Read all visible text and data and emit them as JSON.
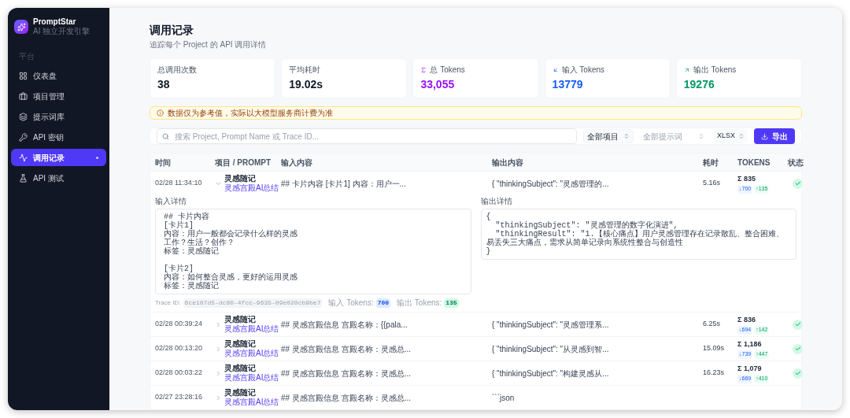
{
  "brand": {
    "name": "PromptStar",
    "tagline": "AI 独立开发引擎"
  },
  "nav_section": "平台",
  "nav": [
    {
      "label": "仪表盘",
      "selected": false
    },
    {
      "label": "项目管理",
      "selected": false
    },
    {
      "label": "提示词库",
      "selected": false
    },
    {
      "label": "API 密钥",
      "selected": false
    },
    {
      "label": "调用记录",
      "selected": true
    },
    {
      "label": "API 测试",
      "selected": false
    }
  ],
  "header": {
    "title": "调用记录",
    "subtitle": "追踪每个 Project 的 API 调用详情"
  },
  "stats": [
    {
      "label": "总调用次数",
      "value": "38",
      "kind": "plain"
    },
    {
      "label": "平均耗时",
      "value": "19.02s",
      "kind": "plain"
    },
    {
      "label": "总 Tokens",
      "value": "33,055",
      "kind": "total"
    },
    {
      "label": "输入 Tokens",
      "value": "13779",
      "kind": "input"
    },
    {
      "label": "输出 Tokens",
      "value": "19276",
      "kind": "output"
    }
  ],
  "notice": "数据仅为参考值，实际以大模型服务商计费为准",
  "filters": {
    "search_placeholder": "搜索 Project, Prompt Name 或 Trace ID...",
    "project": "全部项目",
    "prompt": "全部提示词",
    "format": "XLSX",
    "export": "导出"
  },
  "table": {
    "columns": [
      "时间",
      "项目 / PROMPT",
      "输入内容",
      "输出内容",
      "耗时",
      "TOKENS",
      "状态"
    ],
    "rows": [
      {
        "time": "02/28 11:34:10",
        "project": "灵感随记",
        "prompt": "灵感宫殿AI总结",
        "input": "## 卡片内容 [卡片1] 内容：用户一...",
        "output": "{ \"thinkingSubject\": \"灵感管理的...",
        "duration": "5.16s",
        "total": "Σ 835",
        "in": "↓700",
        "out": "↑135",
        "success": true,
        "expanded": true
      },
      {
        "time": "02/28 00:39:24",
        "project": "灵感随记",
        "prompt": "灵感宫殿AI总结",
        "input": "## 灵感宫殿信息 宫殿名称：{{pala...",
        "output": "{ \"thinkingSubject\": \"灵感管理系...",
        "duration": "6.25s",
        "total": "Σ 836",
        "in": "↓694",
        "out": "↑142",
        "success": true,
        "expanded": false
      },
      {
        "time": "02/28 00:13:20",
        "project": "灵感随记",
        "prompt": "灵感宫殿AI总结",
        "input": "## 灵感宫殿信息 宫殿名称：灵感总...",
        "output": "{ \"thinkingSubject\": \"从灵感到智...",
        "duration": "15.09s",
        "total": "Σ 1,186",
        "in": "↓739",
        "out": "↑447",
        "success": true,
        "expanded": false
      },
      {
        "time": "02/28 00:03:22",
        "project": "灵感随记",
        "prompt": "灵感宫殿AI总结",
        "input": "## 灵感宫殿信息 宫殿名称：灵感总...",
        "output": "{ \"thinkingSubject\": \"构建灵感从...",
        "duration": "16.23s",
        "total": "Σ 1,079",
        "in": "↓669",
        "out": "↑410",
        "success": true,
        "expanded": false
      },
      {
        "time": "02/27 23:28:16",
        "project": "灵感随记",
        "prompt": "灵感宫殿AI总结",
        "input": "## 灵感宫殿信息 宫殿名称：灵感总...",
        "output": "```json",
        "expanded": false
      }
    ],
    "detail": {
      "input_label": "输入详情",
      "input_blocks": [
        [
          "## 卡片内容",
          "[卡片1]",
          "内容：用户一般都会记录什么样的灵感",
          "工作？生活？创作？",
          "标签：灵感随记"
        ],
        [
          "[卡片2]",
          "内容：如何整合灵感，更好的运用灵感",
          "标签：灵感随记"
        ]
      ],
      "output_label": "输出详情",
      "output_text": "{\n  \"thinkingSubject\": \"灵感管理的数字化演进\",\n  \"thinkingResult\": \"1.【核心痛点】用户灵感管理存在记录散乱、整合困难、易丢失三大痛点，需求从简单记录向系统性整合与创造性\n}",
      "trace_label": "Trace ID:",
      "trace_id": "6ce107d5-dc80-4fcc-9635-09e020cb9be7",
      "input_tokens_label": "输入 Tokens:",
      "input_tokens": "700",
      "output_tokens_label": "输出 Tokens:",
      "output_tokens": "135"
    }
  }
}
